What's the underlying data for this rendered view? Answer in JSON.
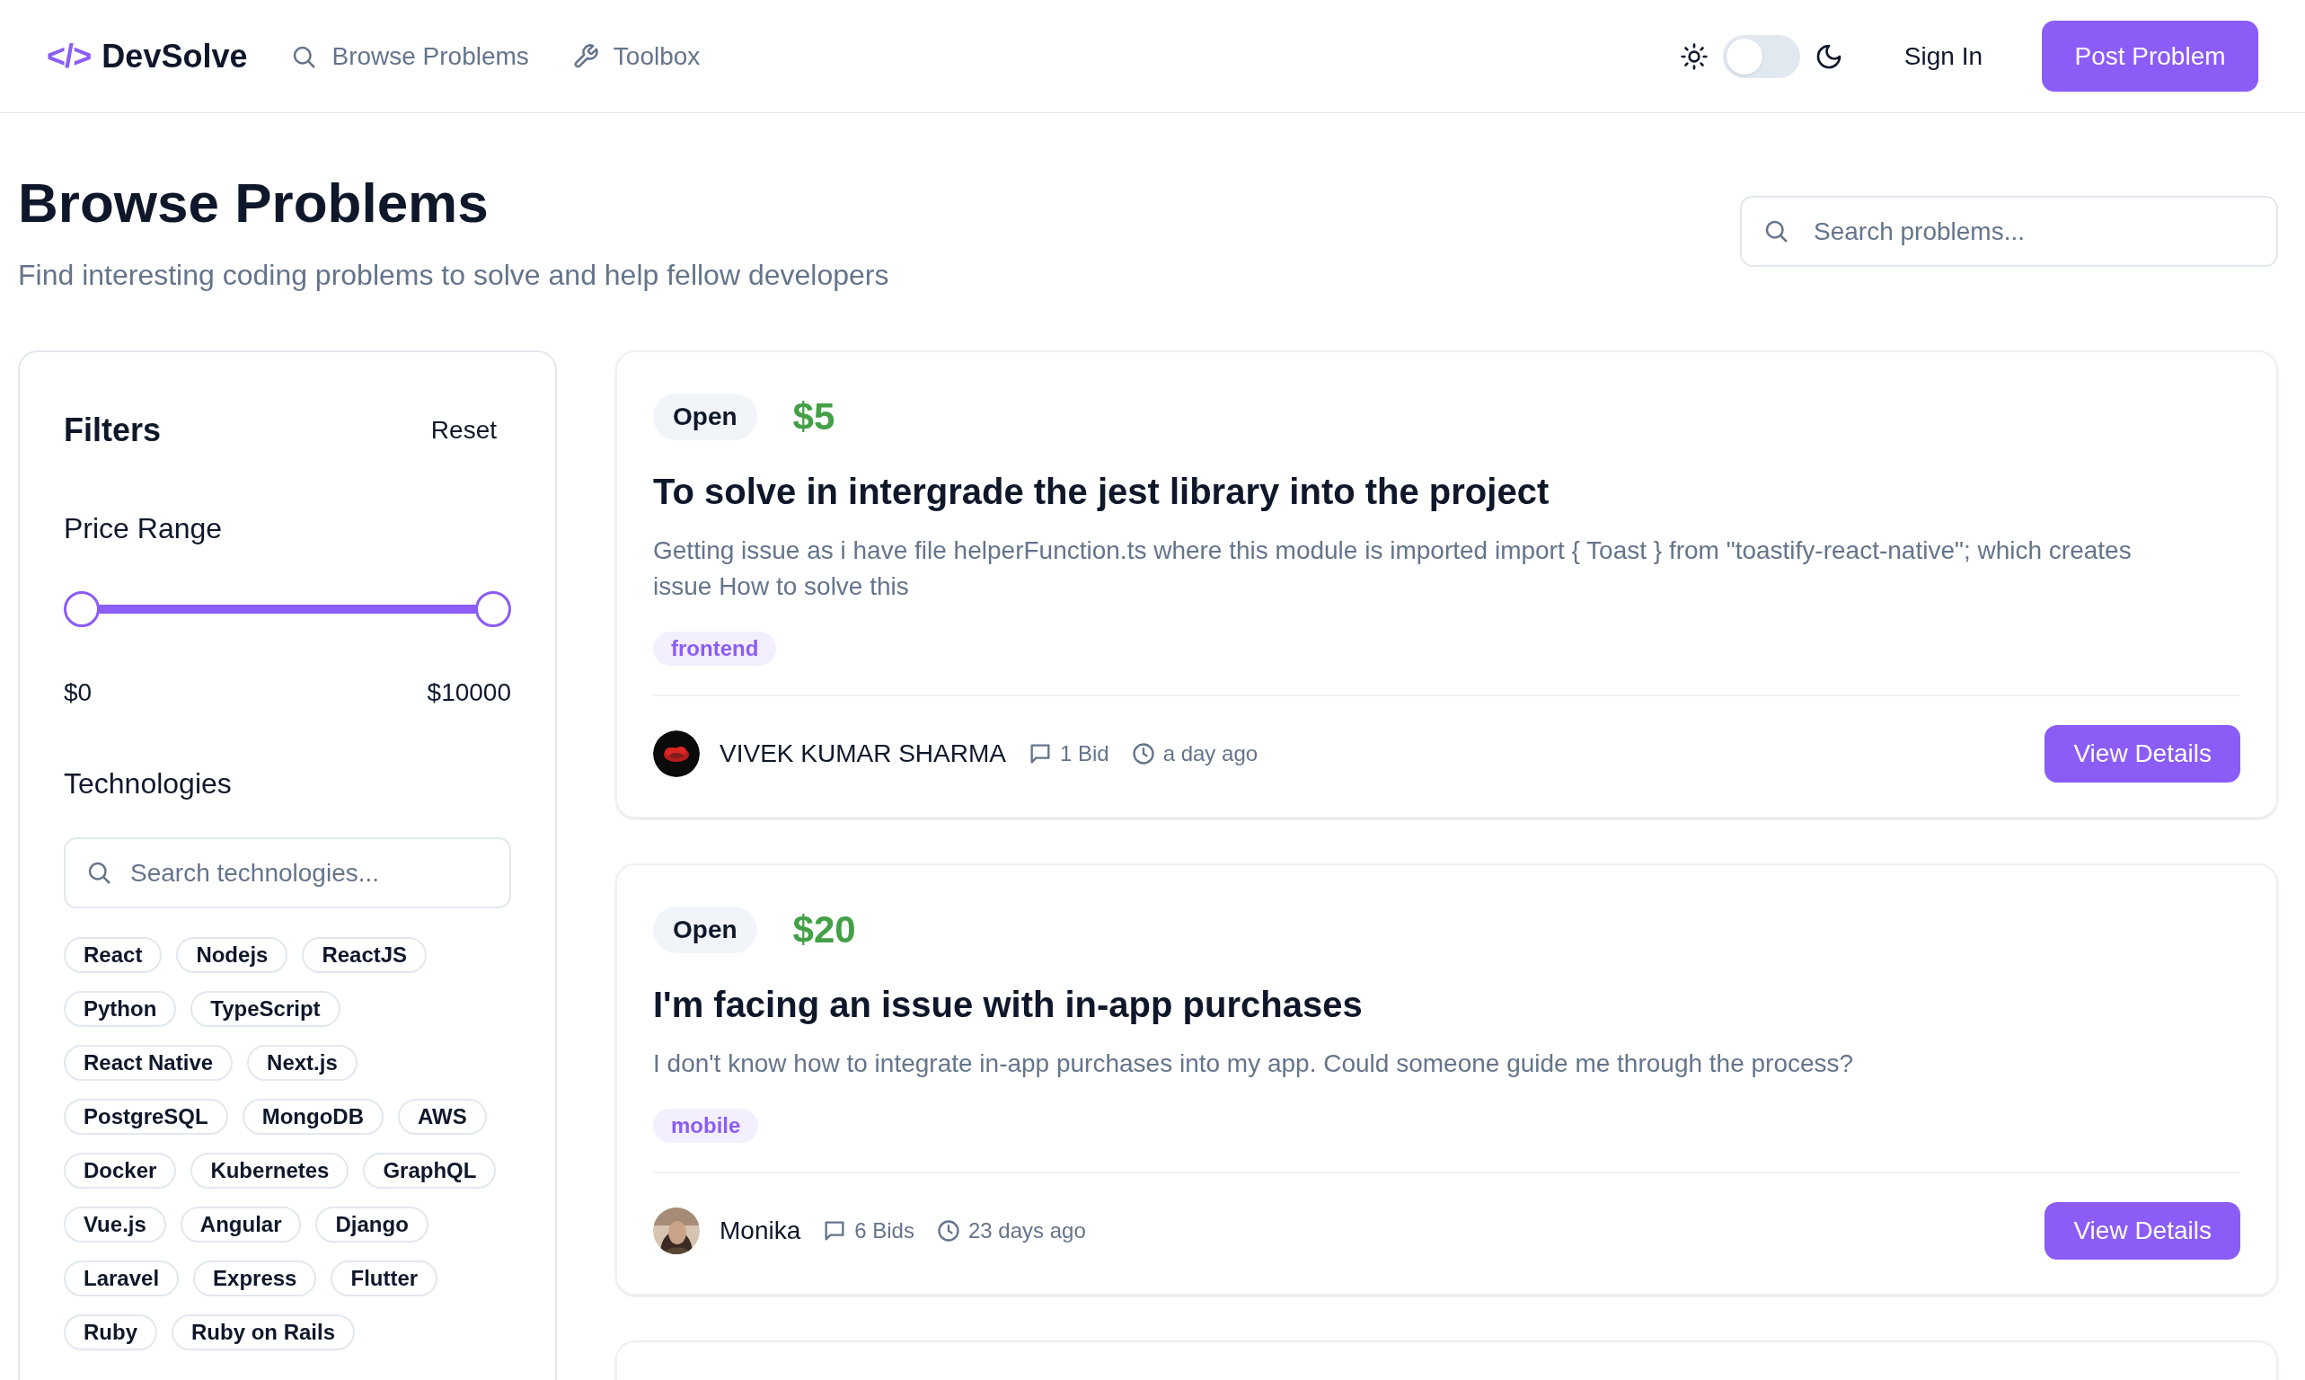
{
  "header": {
    "logo_glyph": "</>",
    "brand": "DevSolve",
    "nav": [
      {
        "label": "Browse Problems"
      },
      {
        "label": "Toolbox"
      }
    ],
    "theme_toggle": {
      "on": false
    },
    "sign_in": "Sign In",
    "post_button": "Post Problem"
  },
  "page": {
    "title": "Browse Problems",
    "subtitle": "Find interesting coding problems to solve and help fellow developers",
    "search": {
      "placeholder": "Search problems..."
    }
  },
  "filters": {
    "title": "Filters",
    "reset": "Reset",
    "price_heading": "Price Range",
    "price_thumbs": [
      {
        "level": 0
      },
      {
        "level": 1
      }
    ],
    "price_min": "$0",
    "price_max": "$10000",
    "tech_heading": "Technologies",
    "tech_search": {
      "placeholder": "Search technologies..."
    },
    "technologies": [
      "React",
      "Nodejs",
      "ReactJS",
      "Python",
      "TypeScript",
      "React Native",
      "Next.js",
      "PostgreSQL",
      "MongoDB",
      "AWS",
      "Docker",
      "Kubernetes",
      "GraphQL",
      "Vue.js",
      "Angular",
      "Django",
      "Laravel",
      "Express",
      "Flutter",
      "Ruby",
      "Ruby on Rails"
    ]
  },
  "problems": [
    {
      "status": "Open",
      "price": "$5",
      "title": "To solve in intergrade the jest library into the project",
      "description": "Getting issue as i have file helperFunction.ts where this module is imported import { Toast } from \"toastify-react-native\"; which creates issue How to solve this",
      "tags": [
        "frontend"
      ],
      "author": "VIVEK KUMAR SHARMA",
      "avatar": {
        "kind": "picture"
      },
      "bids": "1 Bid",
      "time": "a day ago",
      "button": "View Details"
    },
    {
      "status": "Open",
      "price": "$20",
      "title": "I'm facing an issue with in-app purchases",
      "description": "I don't know how to integrate in-app purchases into my app. Could someone guide me through the process?",
      "tags": [
        "mobile"
      ],
      "author": "Monika",
      "avatar": {
        "kind": "picture"
      },
      "bids": "6 Bids",
      "time": "23 days ago",
      "button": "View Details"
    }
  ]
}
